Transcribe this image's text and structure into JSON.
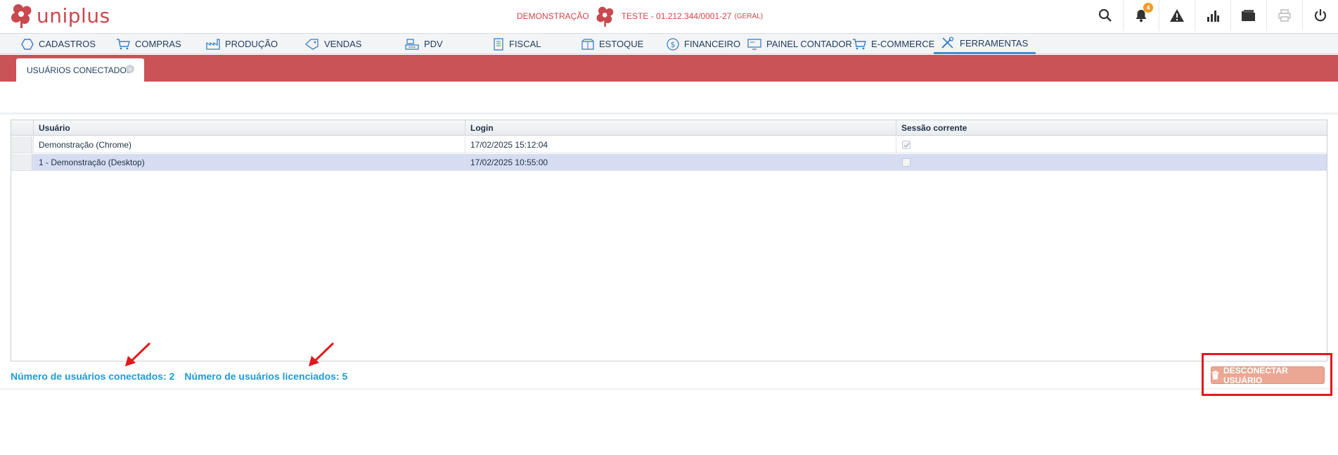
{
  "app": {
    "logo_text": "uniplus",
    "brand_color": "#c8494e"
  },
  "company": {
    "mode": "DEMONSTRAÇÃO",
    "name_cnpj": "TESTE - 01.212.344/0001-27",
    "scope": "(GERAL)"
  },
  "top_icons": {
    "search": "search-icon",
    "notifications": "bell-icon",
    "notifications_count": "4",
    "alerts": "warning-icon",
    "reports": "bar-chart-icon",
    "folder": "folder-icon",
    "print": "printer-icon",
    "power": "power-icon"
  },
  "menu": {
    "items": [
      {
        "label": "CADASTROS",
        "icon": "hexagon-icon"
      },
      {
        "label": "COMPRAS",
        "icon": "cart-icon"
      },
      {
        "label": "PRODUÇÃO",
        "icon": "factory-icon"
      },
      {
        "label": "VENDAS",
        "icon": "tag-icon"
      },
      {
        "label": "PDV",
        "icon": "register-icon"
      },
      {
        "label": "FISCAL",
        "icon": "document-icon"
      },
      {
        "label": "ESTOQUE",
        "icon": "box-icon"
      },
      {
        "label": "FINANCEIRO",
        "icon": "dollar-icon"
      },
      {
        "label": "PAINEL CONTADOR",
        "icon": "monitor-icon"
      },
      {
        "label": "E-COMMERCE",
        "icon": "cart-icon"
      },
      {
        "label": "FERRAMENTAS",
        "icon": "tools-icon",
        "active": true
      }
    ]
  },
  "tab": {
    "label": "USUÁRIOS CONECTADOS",
    "close": "×"
  },
  "grid": {
    "columns": [
      "Usuário",
      "Login",
      "Sessão corrente"
    ],
    "rows": [
      {
        "user": "Demonstração (Chrome)",
        "login": "17/02/2025 15:12:04",
        "current_session": true,
        "selected": false
      },
      {
        "user": "1 - Demonstração (Desktop)",
        "login": "17/02/2025 10:55:00",
        "current_session": false,
        "selected": true
      }
    ]
  },
  "footer": {
    "connected_label": "Número de usuários conectados: 2",
    "licensed_label": "Número de usuários licenciados: 5",
    "disconnect_button": "DESCONECTAR USUÁRIO",
    "disconnect_icon": "trash-icon"
  },
  "colors": {
    "tab_band": "#c95357",
    "counter_text": "#1e9bd8",
    "disconnect_button": "#eba793",
    "highlight_box": "#e0191c",
    "selected_row": "#d6dcf2"
  }
}
